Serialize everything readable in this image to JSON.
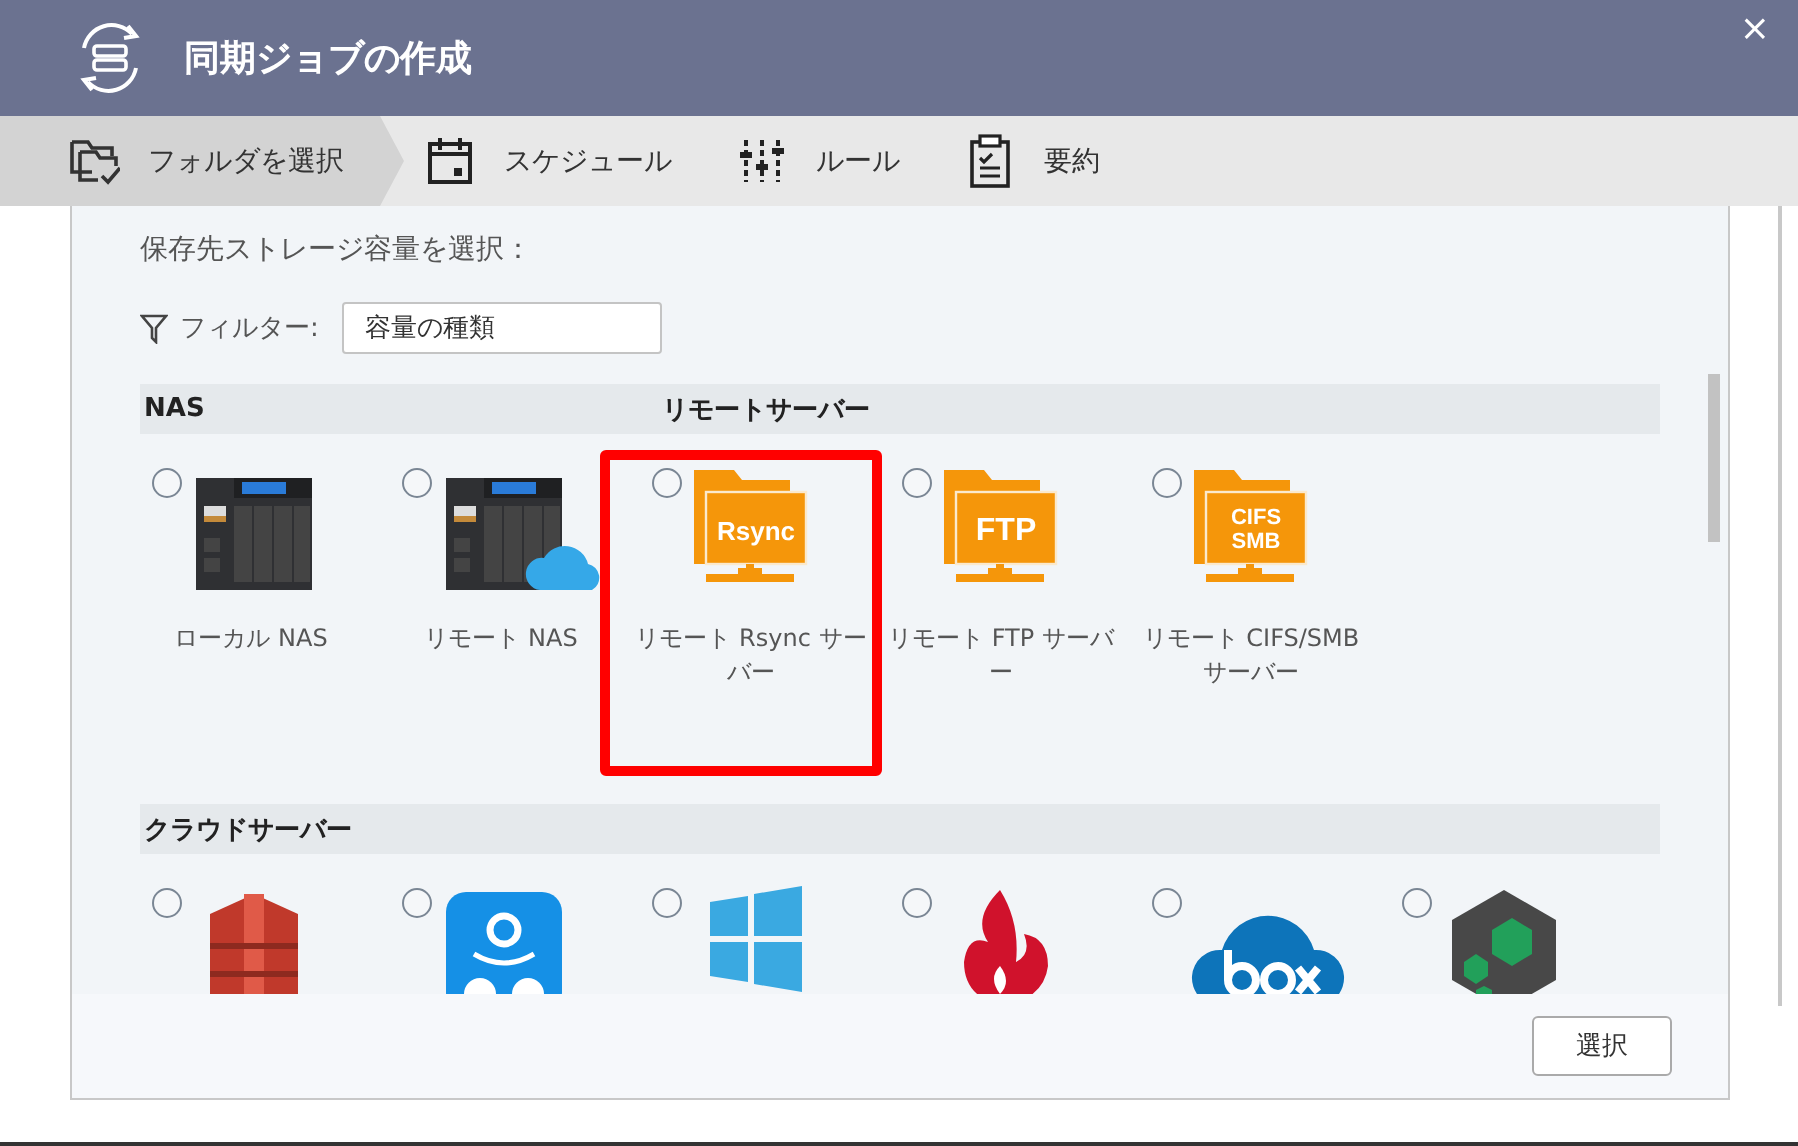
{
  "window": {
    "title": "同期ジョブの作成",
    "close": "×"
  },
  "steps": [
    {
      "label": "フォルダを選択",
      "kind": "folder",
      "selected": true
    },
    {
      "label": "スケジュール",
      "kind": "calendar",
      "selected": false
    },
    {
      "label": "ルール",
      "kind": "sliders",
      "selected": false
    },
    {
      "label": "要約",
      "kind": "clipboard",
      "selected": false
    }
  ],
  "prompt": "保存先ストレージ容量を選択：",
  "filter": {
    "label": "フィルター:",
    "value": "容量の種類"
  },
  "storage_groups": [
    {
      "heading": "NAS",
      "items": [
        {
          "label": "ローカル NAS",
          "kind": "nas",
          "selected": false,
          "highlighted": false
        },
        {
          "label": "リモート NAS",
          "kind": "cloudnas",
          "selected": false,
          "highlighted": false
        }
      ]
    },
    {
      "heading": "リモートサーバー",
      "items": [
        {
          "label": "リモート Rsync サーバー",
          "kind": "folder",
          "badge": [
            "Rsync"
          ],
          "selected": false,
          "highlighted": true
        },
        {
          "label": "リモート FTP サーバー",
          "kind": "folder",
          "badge": [
            "FTP"
          ],
          "selected": false,
          "highlighted": false
        },
        {
          "label": "リモート CIFS/SMB サーバー",
          "kind": "folder",
          "badge": [
            "CIFS",
            "SMB"
          ],
          "selected": false,
          "highlighted": false
        }
      ]
    }
  ],
  "cloud_group": {
    "heading": "クラウドサーバー",
    "items": [
      {
        "kind": "bucket",
        "selected": false
      },
      {
        "kind": "amazon",
        "selected": false
      },
      {
        "kind": "windows",
        "selected": false
      },
      {
        "kind": "flame",
        "selected": false
      },
      {
        "kind": "box",
        "selected": false
      },
      {
        "kind": "hexagon",
        "selected": false
      }
    ]
  },
  "buttons": [
    "選択"
  ]
}
